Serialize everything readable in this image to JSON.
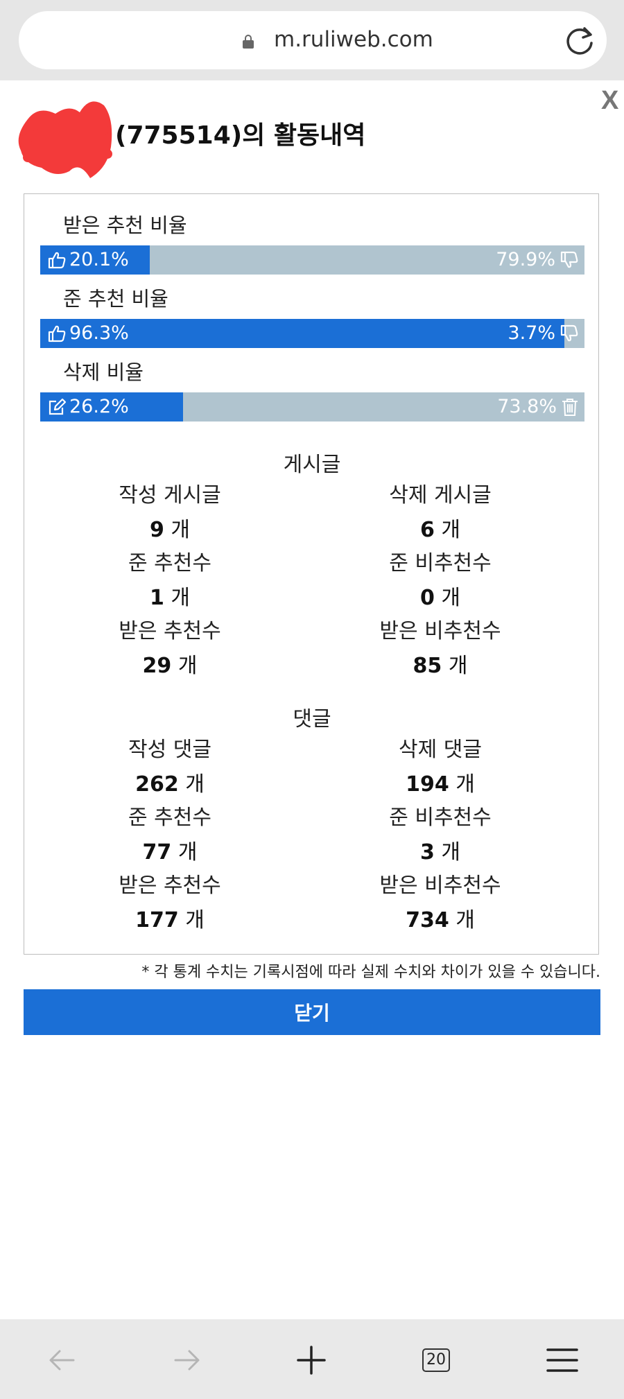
{
  "browser": {
    "url": "m.ruliweb.com",
    "tab_count": "20"
  },
  "dialog": {
    "close_x": "X",
    "title_suffix": "(775514)의 활동내역"
  },
  "ratios": [
    {
      "label": "받은 추천 비율",
      "left_value": "20.1%",
      "right_value": "79.9%",
      "fill_percent": 20.1,
      "left_icon": "thumbs-up-icon",
      "right_icon": "thumbs-down-icon"
    },
    {
      "label": "준 추천 비율",
      "left_value": "96.3%",
      "right_value": "3.7%",
      "fill_percent": 96.3,
      "left_icon": "thumbs-up-icon",
      "right_icon": "thumbs-down-icon"
    },
    {
      "label": "삭제 비율",
      "left_value": "26.2%",
      "right_value": "73.8%",
      "fill_percent": 26.2,
      "left_icon": "edit-icon",
      "right_icon": "trash-icon"
    }
  ],
  "posts": {
    "title": "게시글",
    "stats": [
      {
        "label": "작성 게시글",
        "value": "9",
        "unit": "개"
      },
      {
        "label": "삭제 게시글",
        "value": "6",
        "unit": "개"
      },
      {
        "label": "준 추천수",
        "value": "1",
        "unit": "개"
      },
      {
        "label": "준 비추천수",
        "value": "0",
        "unit": "개"
      },
      {
        "label": "받은 추천수",
        "value": "29",
        "unit": "개"
      },
      {
        "label": "받은 비추천수",
        "value": "85",
        "unit": "개"
      }
    ]
  },
  "comments": {
    "title": "댓글",
    "stats": [
      {
        "label": "작성 댓글",
        "value": "262",
        "unit": "개"
      },
      {
        "label": "삭제 댓글",
        "value": "194",
        "unit": "개"
      },
      {
        "label": "준 추천수",
        "value": "77",
        "unit": "개"
      },
      {
        "label": "준 비추천수",
        "value": "3",
        "unit": "개"
      },
      {
        "label": "받은 추천수",
        "value": "177",
        "unit": "개"
      },
      {
        "label": "받은 비추천수",
        "value": "734",
        "unit": "개"
      }
    ]
  },
  "footnote": "* 각 통계 수치는 기록시점에 따라 실제 수치와 차이가 있을 수 있습니다.",
  "close_button": "닫기",
  "colors": {
    "accent": "#1b6fd6",
    "bar_background": "#b0c4cf"
  }
}
